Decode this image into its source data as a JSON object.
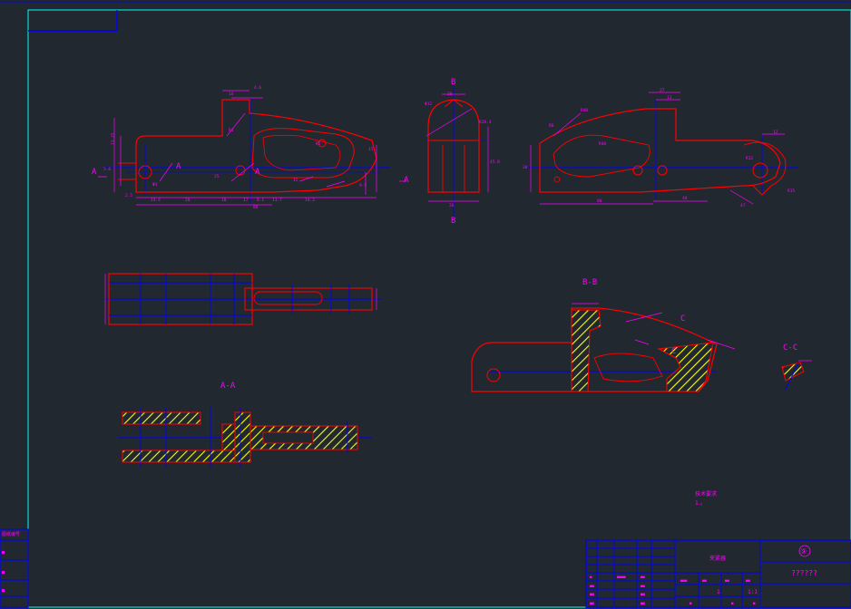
{
  "drawing": {
    "view_labels": {
      "section_aa": "A-A",
      "section_bb": "B-B",
      "section_cc": "C-C",
      "marker_a": "A",
      "marker_b": "B",
      "marker_c": "C"
    },
    "tech_note": {
      "heading": "技术要求",
      "line1": "1.。"
    },
    "title_block": {
      "part_name": "夹紧器",
      "sheet_no": "⑨",
      "title": "??????",
      "scale": "1:1",
      "qty": "1"
    },
    "left_strip": {
      "label": "图纸编号"
    },
    "dimensions": {
      "front_top": [
        "16",
        "4.6",
        "R4",
        "R5"
      ],
      "front_left": [
        "21.25",
        "3.6",
        "Φ3",
        "2.5"
      ],
      "front_bottom": [
        "14.4",
        "20",
        "10",
        "17",
        "8.1",
        "11.7",
        "14.3",
        "80"
      ],
      "front_right": [
        "15",
        "9.5",
        "25",
        "12"
      ],
      "side": [
        "Φ12",
        "30",
        "R28.4",
        "45.8",
        "26"
      ],
      "right_top": [
        "R40",
        "R8",
        "27",
        "13",
        "R40"
      ],
      "right_bottom": [
        "40",
        "80",
        "30"
      ],
      "right_right": [
        "12",
        "R12",
        "R15",
        "47"
      ]
    },
    "colors": {
      "background": "#212830",
      "border": "#00ffff",
      "outline": "#ff0000",
      "centerline": "#0000ff",
      "dimension": "#ff00ff",
      "hatch": "#ffff00",
      "title_grid": "#0000ff"
    }
  }
}
